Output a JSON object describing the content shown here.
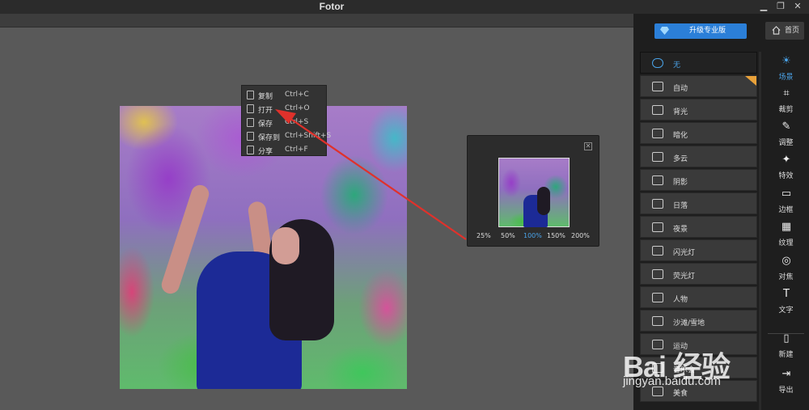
{
  "window": {
    "title": "Fotor",
    "controls": {
      "min_icon": "▁",
      "restore_icon": "❐",
      "close_icon": "✕"
    }
  },
  "context_menu": {
    "items": [
      {
        "label": "复制",
        "shortcut": "Ctrl+C",
        "icon": "copy-icon"
      },
      {
        "label": "打开",
        "shortcut": "Ctrl+O",
        "icon": "open-icon"
      },
      {
        "label": "保存",
        "shortcut": "Ctrl+S",
        "icon": "save-icon"
      },
      {
        "label": "保存到",
        "shortcut": "Ctrl+Shift+S",
        "icon": "save-to-icon"
      },
      {
        "label": "分享",
        "shortcut": "Ctrl+F",
        "icon": "share-icon"
      }
    ]
  },
  "preview": {
    "close_icon": "✕",
    "zoom_options": [
      "25%",
      "50%",
      "100%",
      "150%",
      "200%"
    ],
    "selected_zoom": "100%"
  },
  "header": {
    "upgrade_label": "升级专业版",
    "home_label": "首页"
  },
  "scenes": {
    "items": [
      {
        "label": "无",
        "icon": "none-icon",
        "active": true
      },
      {
        "label": "自动",
        "icon": "camera-icon"
      },
      {
        "label": "背光",
        "icon": "backlight-icon"
      },
      {
        "label": "暗化",
        "icon": "darken-icon"
      },
      {
        "label": "多云",
        "icon": "cloud-icon"
      },
      {
        "label": "阴影",
        "icon": "shade-icon"
      },
      {
        "label": "日落",
        "icon": "sunset-icon"
      },
      {
        "label": "夜景",
        "icon": "night-icon"
      },
      {
        "label": "闪光灯",
        "icon": "flash-icon"
      },
      {
        "label": "荧光灯",
        "icon": "fluorescent-icon"
      },
      {
        "label": "人物",
        "icon": "portrait-icon"
      },
      {
        "label": "沙滩/雪地",
        "icon": "beach-icon"
      },
      {
        "label": "运动",
        "icon": "sport-icon"
      },
      {
        "label": "音乐会",
        "icon": "concert-icon"
      },
      {
        "label": "美食",
        "icon": "food-icon"
      }
    ]
  },
  "tools": {
    "items": [
      {
        "label": "场景",
        "icon": "scene-icon",
        "glyph": "☀",
        "active": true
      },
      {
        "label": "裁剪",
        "icon": "crop-icon",
        "glyph": "⌗"
      },
      {
        "label": "调整",
        "icon": "pen-icon",
        "glyph": "✎"
      },
      {
        "label": "特效",
        "icon": "sparkle-icon",
        "glyph": "✦"
      },
      {
        "label": "边框",
        "icon": "frame-icon",
        "glyph": "▭"
      },
      {
        "label": "纹理",
        "icon": "texture-icon",
        "glyph": "▦"
      },
      {
        "label": "对焦",
        "icon": "focus-icon",
        "glyph": "◎"
      },
      {
        "label": "文字",
        "icon": "text-icon",
        "glyph": "T"
      },
      {
        "label": "新建",
        "icon": "new-file-icon",
        "glyph": "▯"
      },
      {
        "label": "导出",
        "icon": "export-icon",
        "glyph": "⇥"
      }
    ]
  },
  "watermark": {
    "logo": "Bai 经验",
    "url": "jingyan.baidu.com"
  },
  "colors": {
    "accent": "#4aa3e8",
    "upgrade_button": "#2b7fd8",
    "arrow": "#e0312b",
    "badge": "#e8a13a"
  }
}
